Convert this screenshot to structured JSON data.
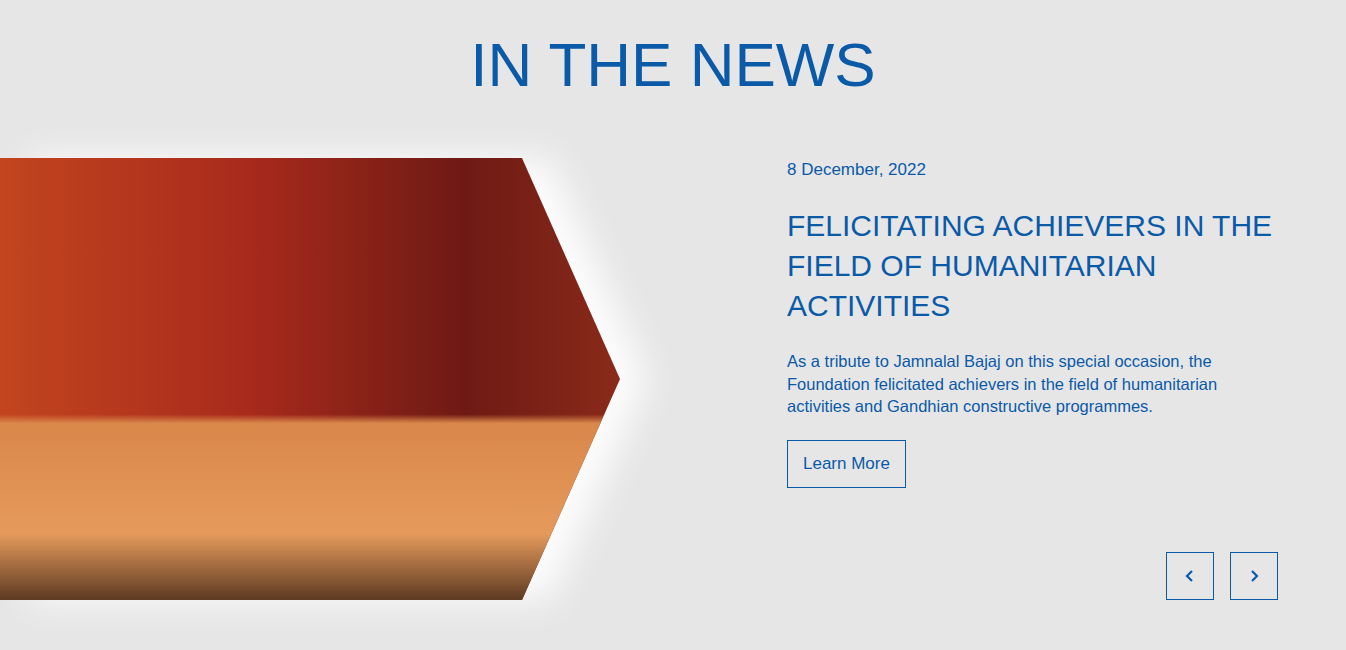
{
  "section": {
    "title": "IN THE NEWS"
  },
  "article": {
    "date": "8 December, 2022",
    "heading": "FELICITATING ACHIEVERS IN THE FIELD OF HUMANITARIAN ACTIVITIES",
    "description": "As a tribute to Jamnalal Bajaj on this special occasion, the Foundation felicitated achievers in the field of humanitarian activities and Gandhian constructive programmes.",
    "button": "Learn More"
  }
}
